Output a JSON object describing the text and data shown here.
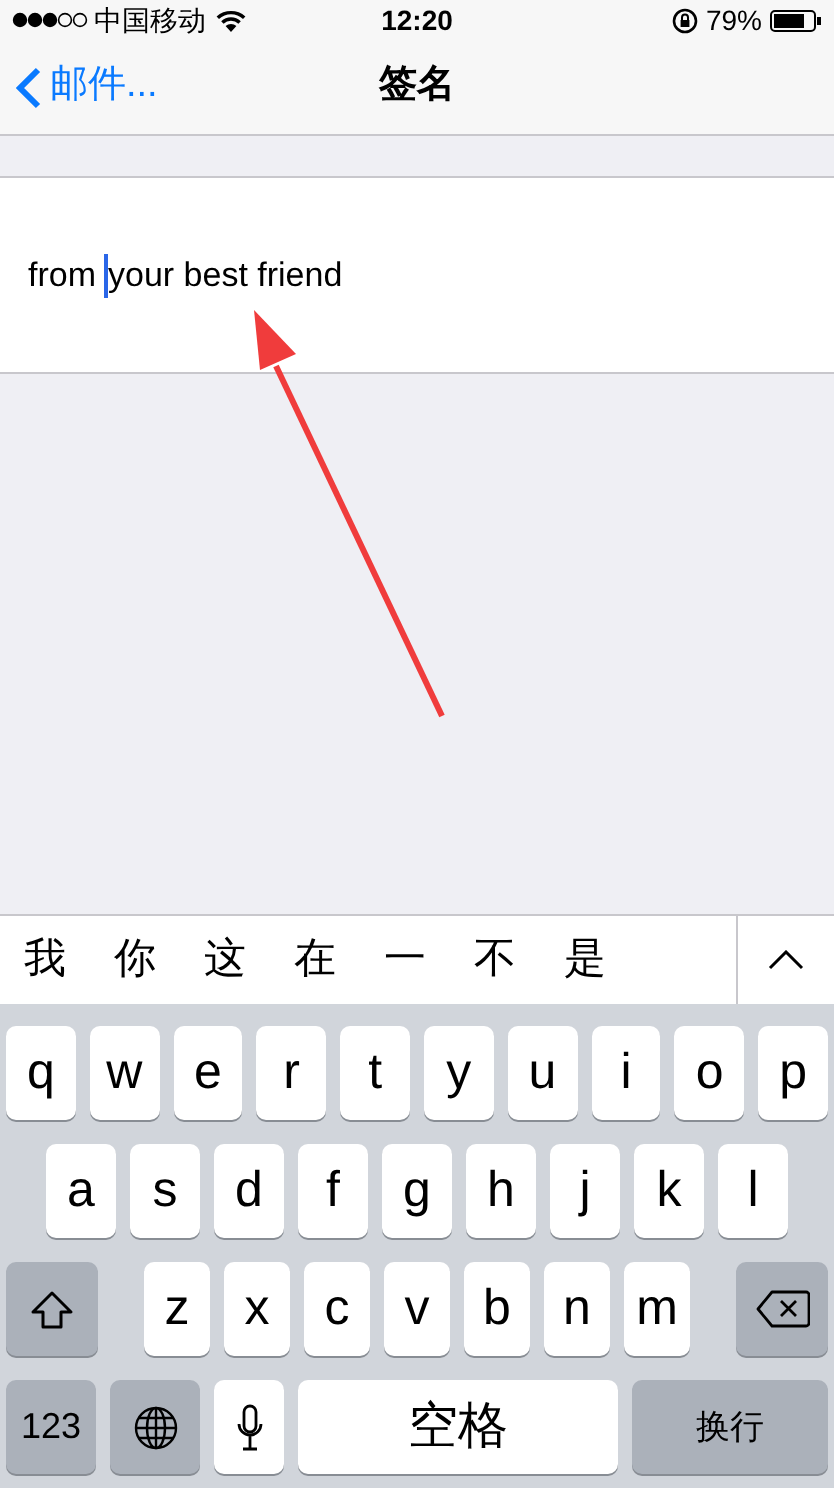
{
  "status_bar": {
    "carrier": "中国移动",
    "time": "12:20",
    "battery": "79%"
  },
  "nav": {
    "back": "邮件...",
    "title": "签名"
  },
  "signature": {
    "text_before_cursor": "from",
    "text_after_cursor": "your best friend"
  },
  "suggestions": [
    "我",
    "你",
    "这",
    "在",
    "一",
    "不",
    "是"
  ],
  "keyboard": {
    "rows": [
      [
        "q",
        "w",
        "e",
        "r",
        "t",
        "y",
        "u",
        "i",
        "o",
        "p"
      ],
      [
        "a",
        "s",
        "d",
        "f",
        "g",
        "h",
        "j",
        "k",
        "l"
      ],
      [
        "z",
        "x",
        "c",
        "v",
        "b",
        "n",
        "m"
      ]
    ],
    "numbers": "123",
    "space": "空格",
    "return": "换行"
  }
}
